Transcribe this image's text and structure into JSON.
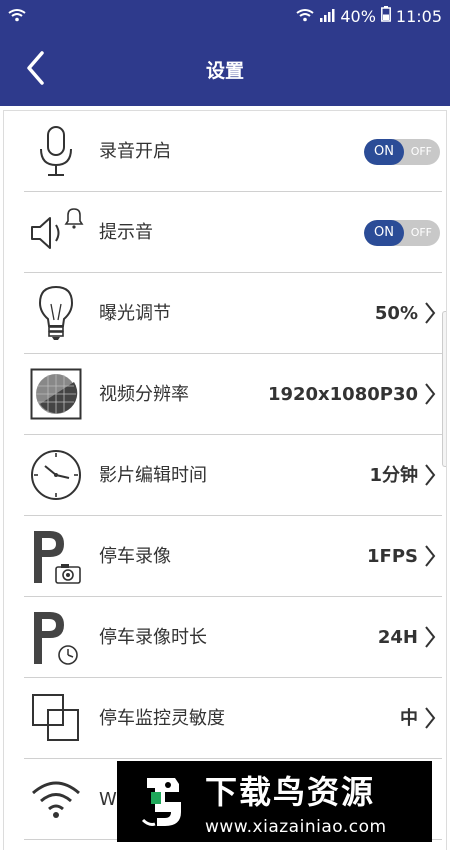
{
  "status": {
    "battery": "40%",
    "time": "11:05"
  },
  "header": {
    "title": "设置"
  },
  "settings": [
    {
      "label": "录音开启",
      "icon": "microphone-icon",
      "toggle": {
        "on": "ON",
        "off": "OFF"
      }
    },
    {
      "label": "提示音",
      "icon": "speaker-bell-icon",
      "toggle": {
        "on": "ON",
        "off": "OFF"
      }
    },
    {
      "label": "曝光调节",
      "icon": "lightbulb-icon",
      "value": "50%"
    },
    {
      "label": "视频分辨率",
      "icon": "resolution-icon",
      "value": "1920x1080P30"
    },
    {
      "label": "影片编辑时间",
      "icon": "clock-icon",
      "value": "1分钟"
    },
    {
      "label": "停车录像",
      "icon": "parking-camera-icon",
      "value": "1FPS"
    },
    {
      "label": "停车录像时长",
      "icon": "parking-clock-icon",
      "value": "24H"
    },
    {
      "label": "停车监控灵敏度",
      "icon": "overlap-squares-icon",
      "value": "中"
    },
    {
      "label": "Wi",
      "icon": "wifi-icon"
    }
  ],
  "watermark": {
    "title": "下载鸟资源",
    "url": "www.xiazainiao.com"
  },
  "colors": {
    "header_bg": "#2e3a8c",
    "toggle_on": "#2b4c97",
    "toggle_off": "#c8c8c8"
  }
}
